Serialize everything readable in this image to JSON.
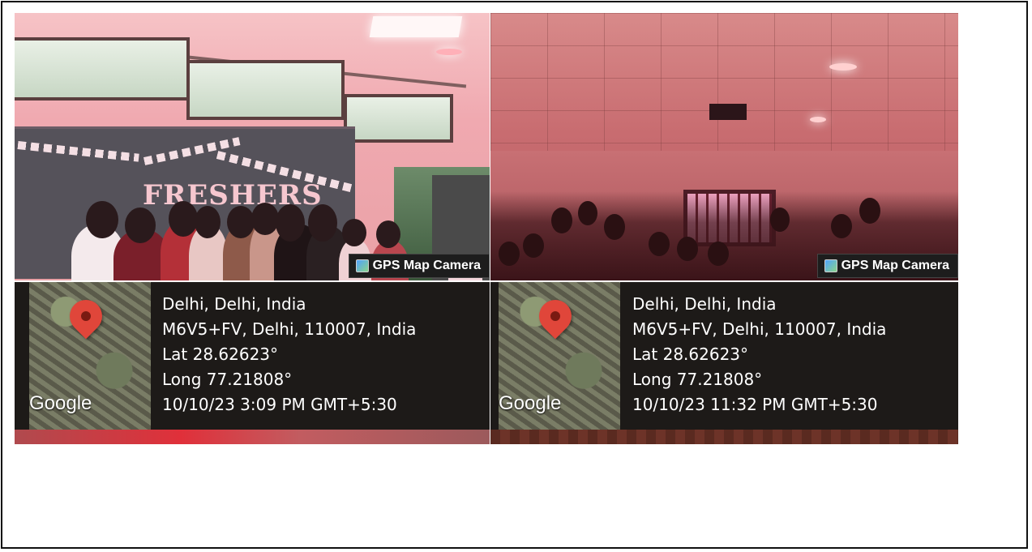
{
  "photos": [
    {
      "scene_text": "FRESHERS",
      "watermark": "GPS Map Camera",
      "map_brand": "Google",
      "location": "Delhi, Delhi, India",
      "address": "M6V5+FV, Delhi, 110007, India",
      "lat": "Lat 28.62623°",
      "long": "Long 77.21808°",
      "datetime": "10/10/23 3:09 PM GMT+5:30"
    },
    {
      "watermark": "GPS Map Camera",
      "map_brand": "Google",
      "location": "Delhi, Delhi, India",
      "address": "M6V5+FV, Delhi, 110007, India",
      "lat": "Lat 28.62623°",
      "long": "Long 77.21808°",
      "datetime": "10/10/23 11:32 PM GMT+5:30"
    }
  ],
  "icons": {
    "camera": "camera-icon",
    "pin": "map-pin-icon"
  },
  "colors": {
    "info_panel": "#1d1a18",
    "pin": "#e0463a",
    "text": "#ffffff"
  }
}
